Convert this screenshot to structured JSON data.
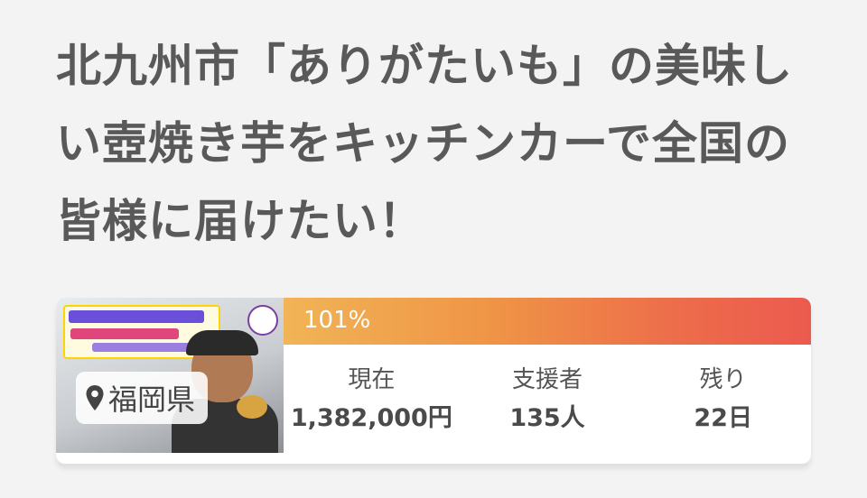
{
  "title": "北九州市「ありがたいも」の美味しい壺焼き芋をキッチンカーで全国の皆様に届けたい！",
  "project": {
    "location": "福岡県",
    "location_icon": "map-pin-icon",
    "progress_label": "101%",
    "progress_percent": 101,
    "progress_colors": [
      "#f1b456",
      "#ec5a4f"
    ],
    "stats": [
      {
        "label": "現在",
        "value": "1,382,000円"
      },
      {
        "label": "支援者",
        "value": "135人"
      },
      {
        "label": "残り",
        "value": "22日"
      }
    ]
  }
}
